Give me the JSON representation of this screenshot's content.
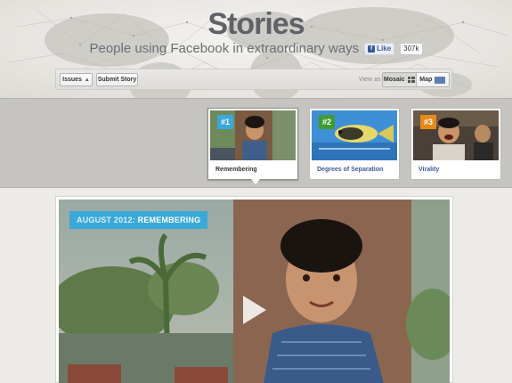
{
  "header": {
    "title": "Stories",
    "subtitle": "People using Facebook in extraordinary ways",
    "like_label": "Like",
    "like_count": "307k"
  },
  "toolbar": {
    "issues_label": "Issues",
    "submit_label": "Submit Story",
    "view_as_label": "View as",
    "mosaic_label": "Mosaic",
    "map_label": "Map"
  },
  "stories": [
    {
      "number": "#1",
      "label": "Remembering",
      "badge_color": "#3aa9d8",
      "active": true
    },
    {
      "number": "#2",
      "label": "Degrees of Separation",
      "badge_color": "#3f9c35",
      "active": false
    },
    {
      "number": "#3",
      "label": "Virality",
      "badge_color": "#e68a1d",
      "active": false
    }
  ],
  "feature": {
    "tag_prefix": "AUGUST 2012: ",
    "tag_title": "REMEMBERING"
  },
  "icons": {
    "caret": "caret-up-icon",
    "mosaic": "grid-icon",
    "map": "world-map-icon",
    "play": "play-icon",
    "like": "thumbs-up-icon"
  }
}
